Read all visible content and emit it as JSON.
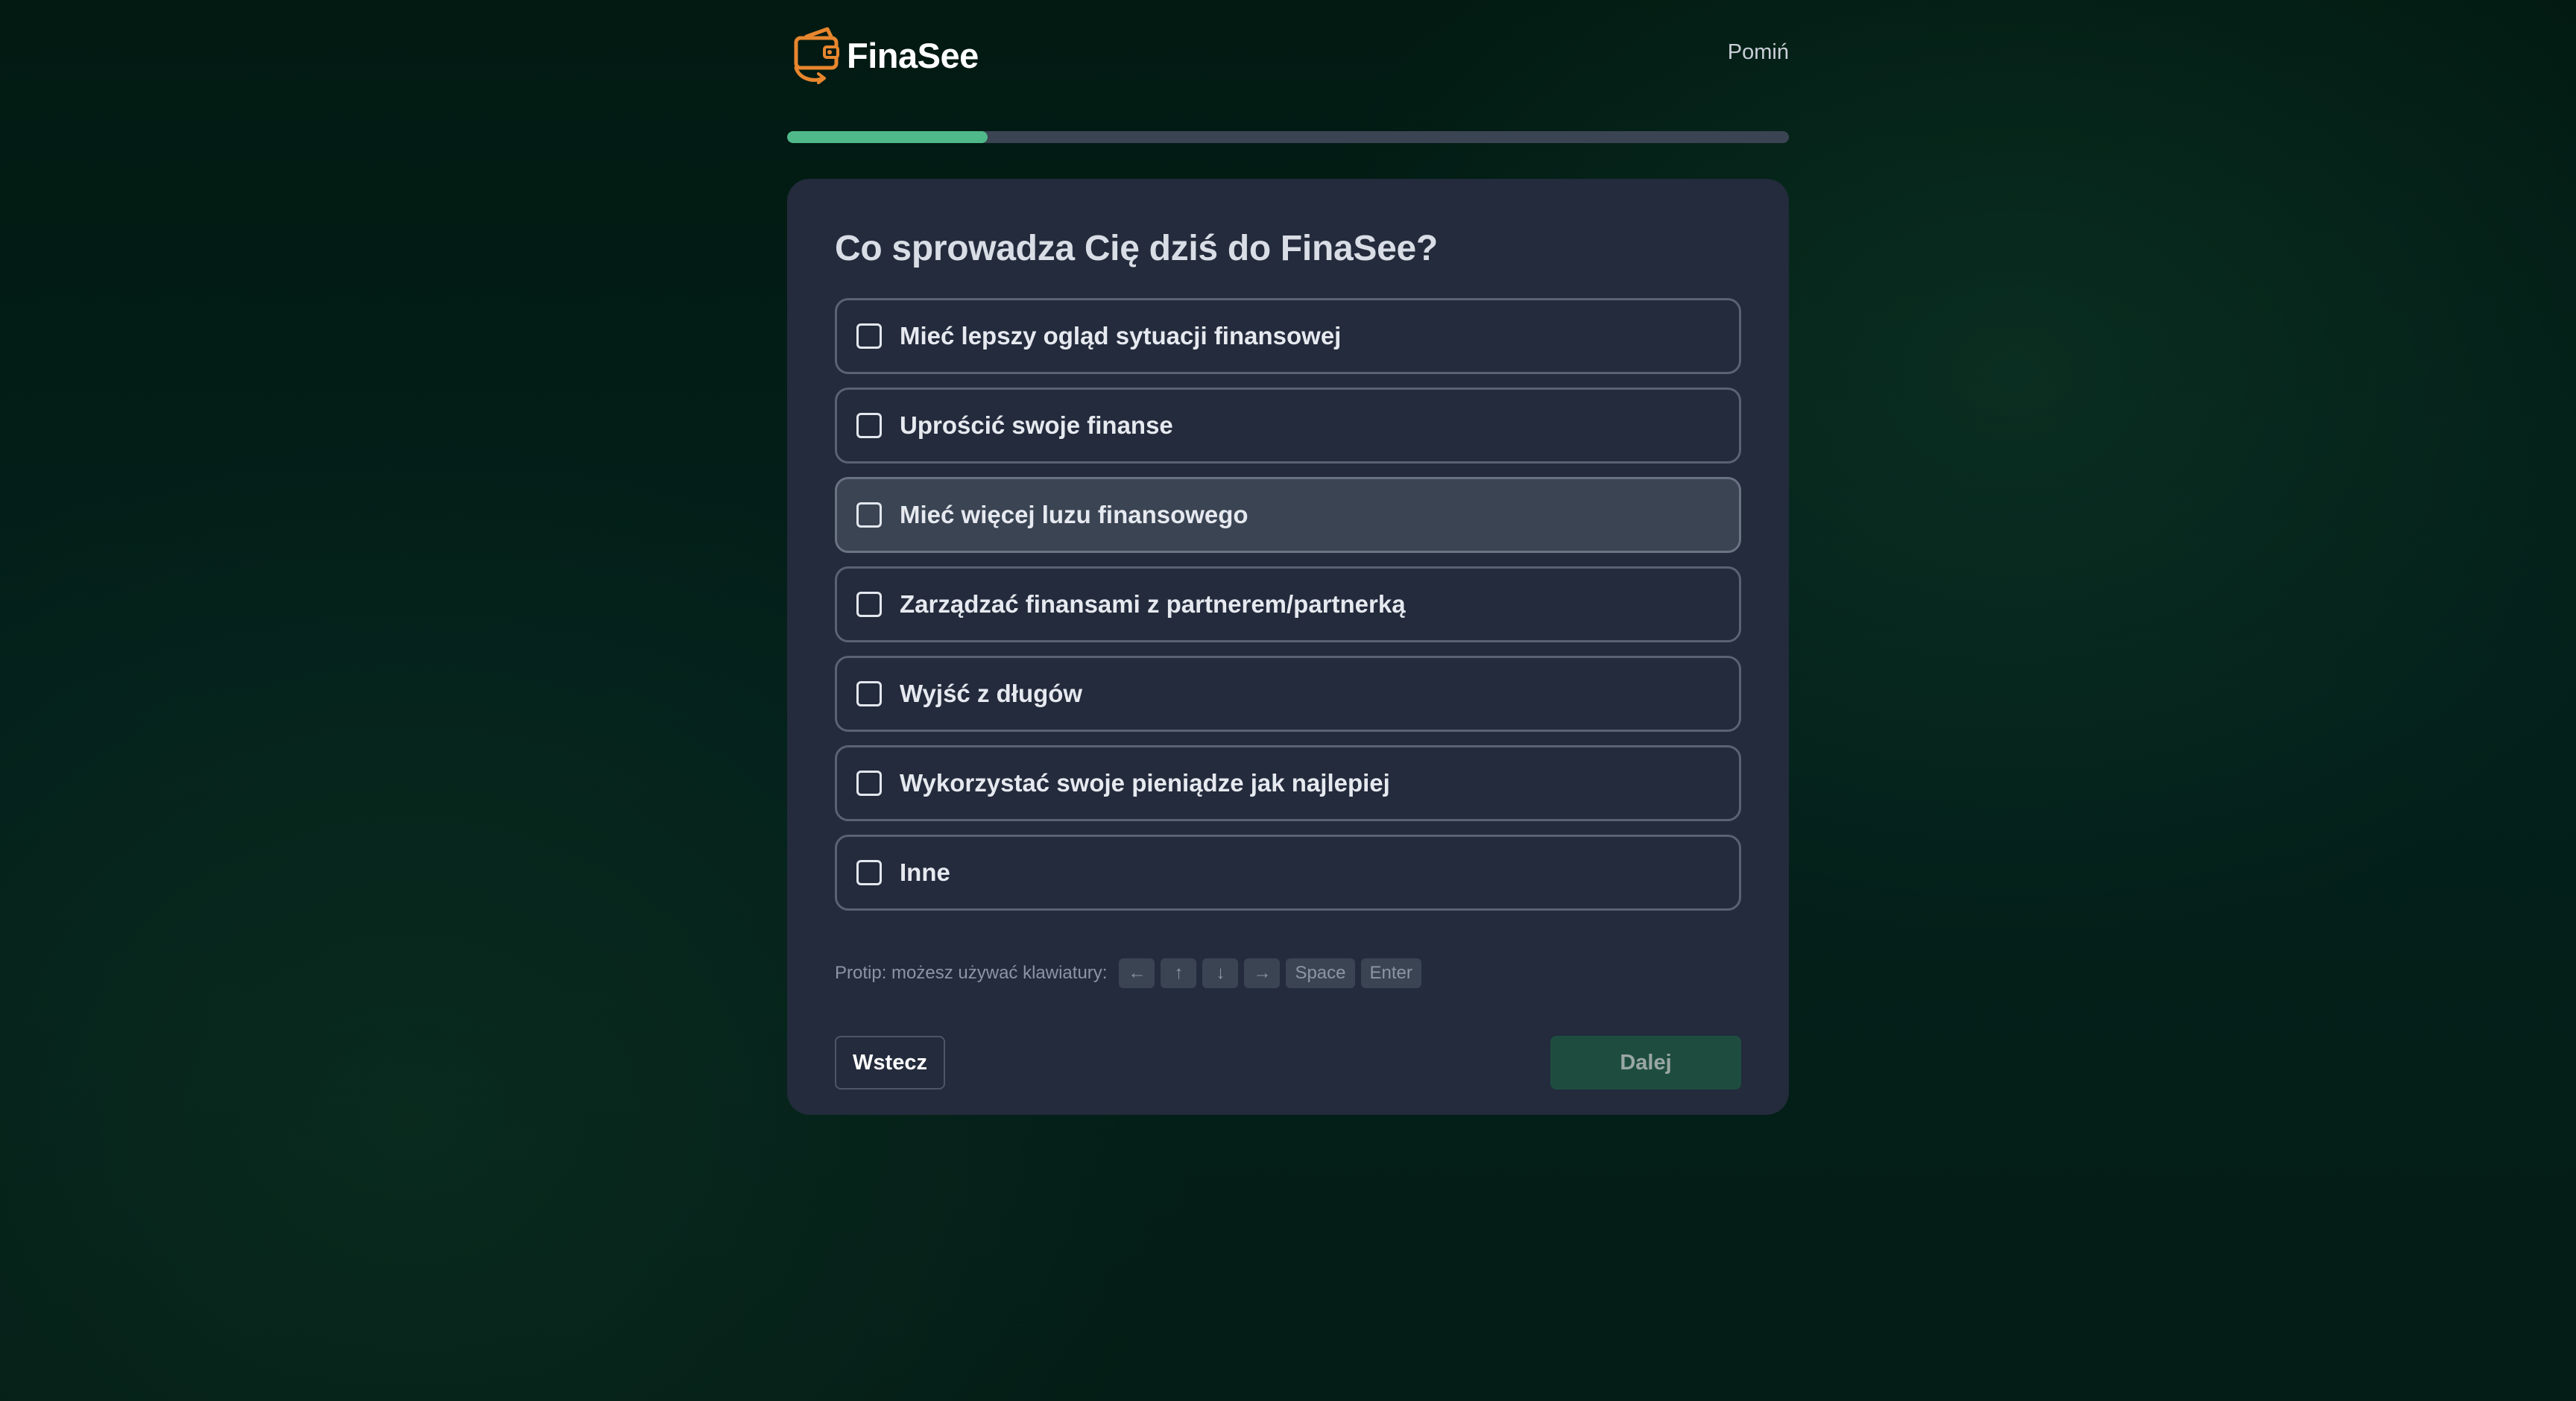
{
  "brand": {
    "name": "FinaSee",
    "logo_icon": "wallet-refresh-icon",
    "logo_color": "#e8862e"
  },
  "header": {
    "skip_label": "Pomiń"
  },
  "progress": {
    "fraction": 0.2,
    "fill_color": "#4fb98a",
    "track_color": "#3a4453"
  },
  "question": {
    "title": "Co sprowadza Cię dziś do FinaSee?"
  },
  "options": [
    {
      "label": "Mieć lepszy ogląd sytuacji finansowej",
      "checked": false,
      "hovered": false
    },
    {
      "label": "Uprościć swoje finanse",
      "checked": false,
      "hovered": false
    },
    {
      "label": "Mieć więcej luzu finansowego",
      "checked": false,
      "hovered": true
    },
    {
      "label": "Zarządzać finansami z partnerem/partnerką",
      "checked": false,
      "hovered": false
    },
    {
      "label": "Wyjść z długów",
      "checked": false,
      "hovered": false
    },
    {
      "label": "Wykorzystać swoje pieniądze jak najlepiej",
      "checked": false,
      "hovered": false
    },
    {
      "label": "Inne",
      "checked": false,
      "hovered": false
    }
  ],
  "protip": {
    "text": "Protip: możesz używać klawiatury:",
    "keys": [
      "←",
      "↑",
      "↓",
      "→",
      "Space",
      "Enter"
    ]
  },
  "actions": {
    "back_label": "Wstecz",
    "next_label": "Dalej",
    "next_color": "#1e4d40"
  }
}
